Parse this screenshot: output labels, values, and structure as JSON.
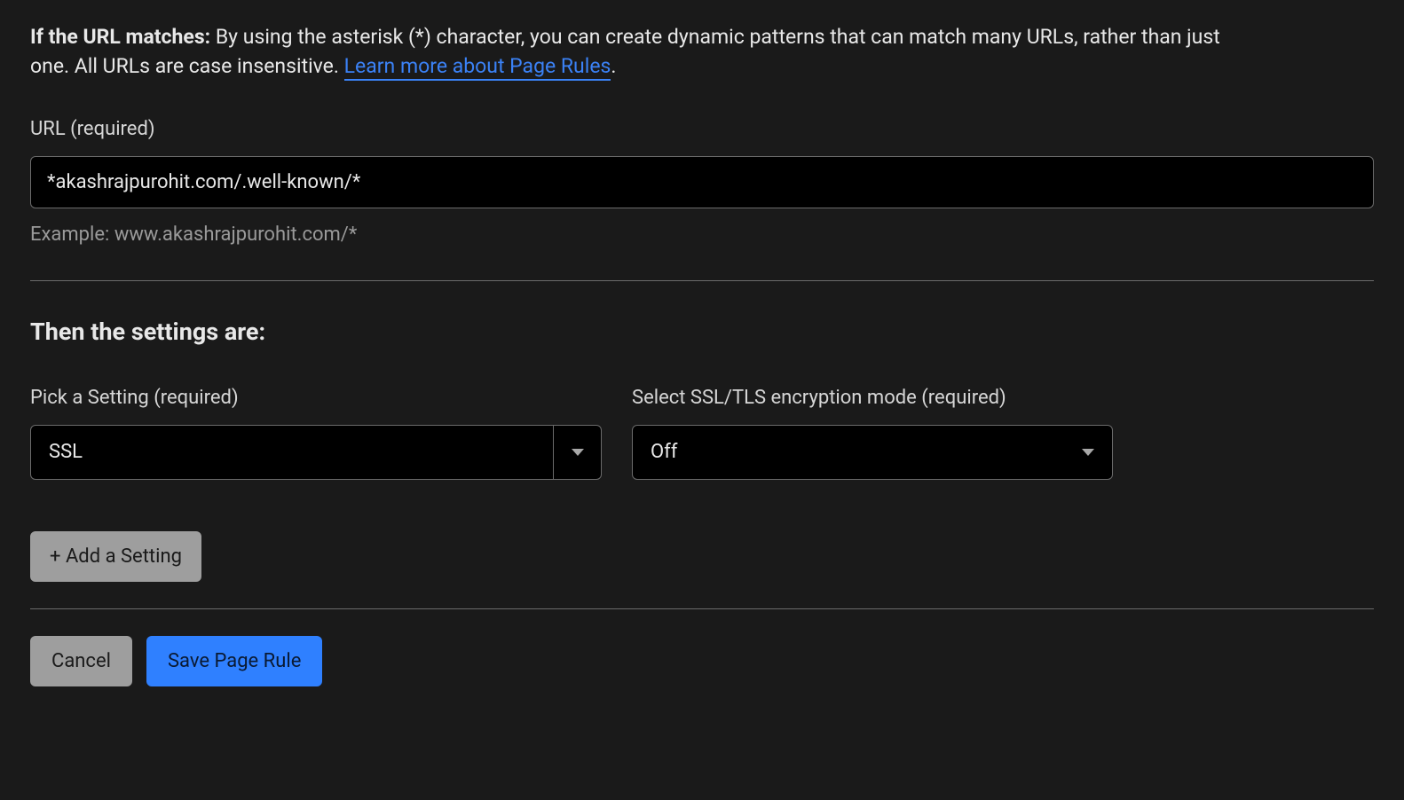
{
  "intro": {
    "bold_prefix": "If the URL matches:",
    "body": " By using the asterisk (*) character, you can create dynamic patterns that can match many URLs, rather than just one. All URLs are case insensitive. ",
    "link_text": "Learn more about Page Rules",
    "period": "."
  },
  "url_field": {
    "label": "URL (required)",
    "value": "*akashrajpurohit.com/.well-known/*",
    "example": "Example: www.akashrajpurohit.com/*"
  },
  "settings": {
    "heading": "Then the settings are:",
    "pick_label": "Pick a Setting (required)",
    "pick_value": "SSL",
    "mode_label": "Select SSL/TLS encryption mode (required)",
    "mode_value": "Off",
    "add_button": "+ Add a Setting"
  },
  "footer": {
    "cancel": "Cancel",
    "save": "Save Page Rule"
  }
}
